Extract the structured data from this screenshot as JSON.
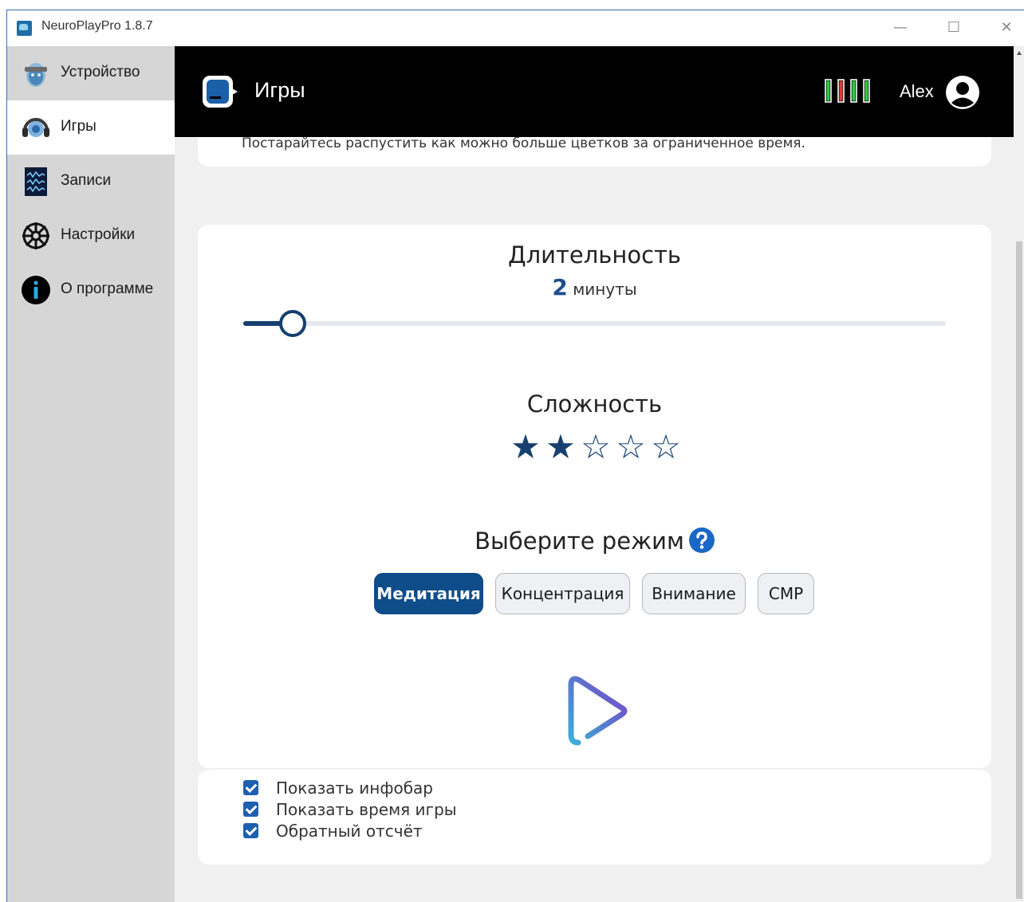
{
  "window": {
    "title": "NeuroPlayPro 1.8.7",
    "controls": {
      "minimize": "—",
      "maximize": "☐",
      "close": "✕"
    }
  },
  "sidebar": {
    "items": [
      {
        "label": "Устройство",
        "icon": "device-headset-icon",
        "active": false
      },
      {
        "label": "Игры",
        "icon": "games-headphones-icon",
        "active": true
      },
      {
        "label": "Записи",
        "icon": "recordings-eeg-icon",
        "active": false
      },
      {
        "label": "Настройки",
        "icon": "settings-gear-icon",
        "active": false
      },
      {
        "label": "О программе",
        "icon": "info-icon",
        "active": false
      }
    ]
  },
  "header": {
    "title": "Игры",
    "user": "Alex",
    "signal_colors": [
      "#2ecc40",
      "#e03b3b",
      "#2ecc40",
      "#2ecc40"
    ]
  },
  "main": {
    "description": "Постарайтесь распустить как можно больше цветков за ограниченное время.",
    "duration": {
      "title": "Длительность",
      "value": "2",
      "unit": "минуты",
      "slider_fraction": 0.07
    },
    "difficulty": {
      "title": "Сложность",
      "filled_stars": 2,
      "total_stars": 5
    },
    "mode": {
      "title": "Выберите режим",
      "options": [
        "Медитация",
        "Концентрация",
        "Внимание",
        "СМР"
      ],
      "selected": "Медитация"
    },
    "play_icon": "play-icon"
  },
  "options": {
    "items": [
      {
        "label": "Показать инфобар",
        "checked": true
      },
      {
        "label": "Показать время игры",
        "checked": true
      },
      {
        "label": "Обратный отсчёт",
        "checked": true
      }
    ]
  },
  "colors": {
    "accent": "#0f4c8a",
    "slider": "#15406f",
    "sidebar_bg": "#d6d6d6",
    "header_bg": "#000000"
  }
}
